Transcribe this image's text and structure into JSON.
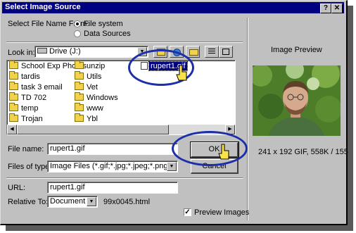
{
  "window": {
    "title": "Select Image Source",
    "help_btn": "?",
    "close_btn": "✕"
  },
  "select_from": {
    "label": "Select File Name From:",
    "options": [
      {
        "label": "File system",
        "selected": true
      },
      {
        "label": "Data Sources",
        "selected": false
      }
    ]
  },
  "look_in": {
    "label": "Look in:",
    "value": "Drive (J:)"
  },
  "files": {
    "col1": [
      "School Exp Photos",
      "tardis",
      "task 3 email",
      "TD 702",
      "temp",
      "Trojan"
    ],
    "col2": [
      "unzip",
      "Utils",
      "Vet",
      "Windows",
      "www",
      "Ybl"
    ],
    "selected": "rupert1.gif"
  },
  "file_name": {
    "label": "File name:",
    "value": "rupert1.gif"
  },
  "files_of_type": {
    "label": "Files of type:",
    "value": "Image Files (*.gif;*.jpg;*.jpeg;*.png)"
  },
  "buttons": {
    "ok": "OK",
    "cancel": "Cancel"
  },
  "url": {
    "label": "URL:",
    "value": "rupert1.gif"
  },
  "relative_to": {
    "label": "Relative To:",
    "value": "Document",
    "file": "99x0045.html"
  },
  "preview": {
    "title": "Image Preview",
    "info": "241 x 192 GIF, 558K / 155",
    "checkbox_label": "Preview Images",
    "checkbox_checked": true
  },
  "colors": {
    "titlebar": "#000080",
    "annotation_ring": "#1c2fa8",
    "dialog_bg": "#c0c0c0"
  }
}
